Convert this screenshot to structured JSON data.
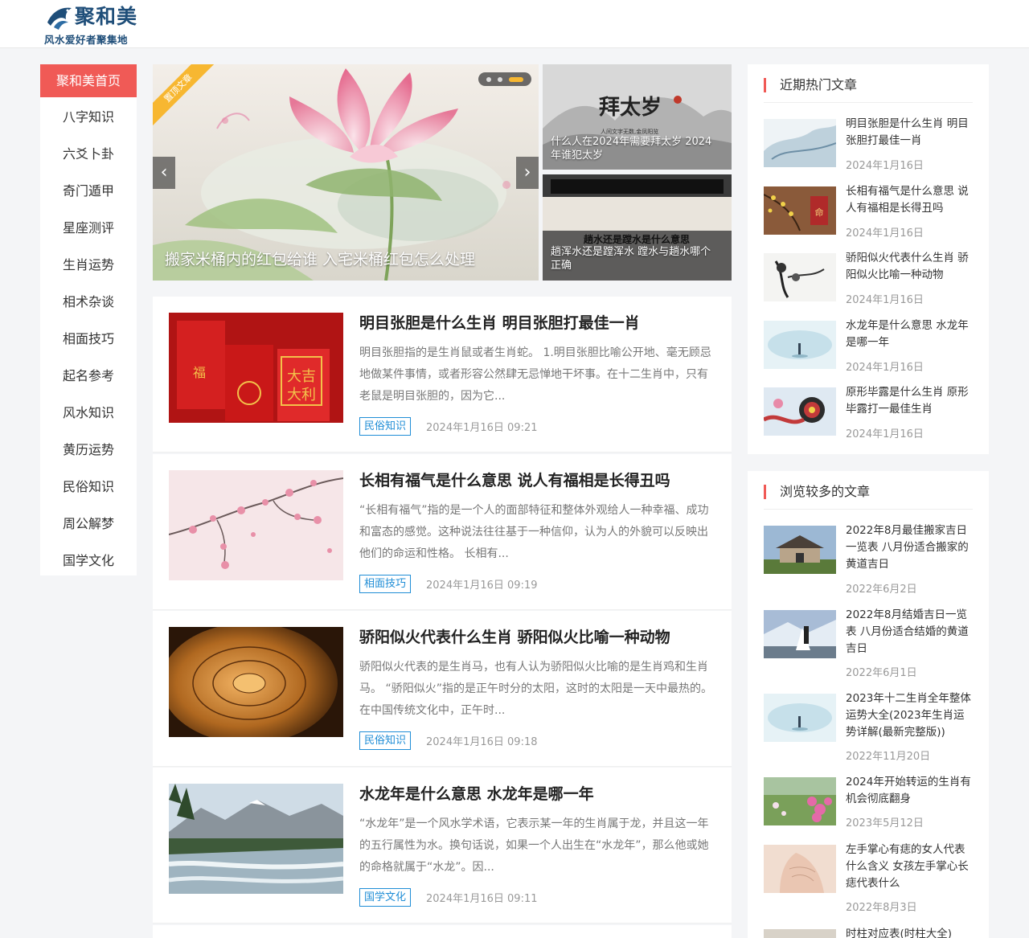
{
  "header": {
    "logo_main": "聚和美",
    "logo_sub": "风水爱好者聚集地"
  },
  "nav": {
    "items": [
      "聚和美首页",
      "八字知识",
      "六爻卜卦",
      "奇门遁甲",
      "星座测评",
      "生肖运势",
      "相术杂谈",
      "相面技巧",
      "起名参考",
      "风水知识",
      "黄历运势",
      "民俗知识",
      "周公解梦",
      "国学文化"
    ]
  },
  "banner": {
    "ribbon": "置顶文章",
    "title": "搬家米桶内的红包给谁 入宅米桶红包怎么处理",
    "prev": "‹",
    "next": "›",
    "side": [
      {
        "art_text": "拜太岁",
        "art_small": "人间文字无数,金凤阳览",
        "caption_1": "什么人在2024年需要拜太岁 2024",
        "caption_2": "年谁犯太岁"
      },
      {
        "art_text": "趟水还是蹚水是什么意思",
        "caption_1": "趟浑水还是蹚浑水 蹚水与趟水哪个",
        "caption_2": "正确"
      }
    ]
  },
  "articles": [
    {
      "title": "明目张胆是什么生肖 明目张胆打最佳一肖",
      "desc": "明目张胆指的是生肖鼠或者生肖蛇。 1.明目张胆比喻公开地、毫无顾忌地做某件事情，或者形容公然肆无忌惮地干坏事。在十二生肖中，只有老鼠是明目张胆的，因为它...",
      "tag": "民俗知识",
      "time": "2024年1月16日 09:21"
    },
    {
      "title": "长相有福气是什么意思 说人有福相是长得丑吗",
      "desc": "“长相有福气”指的是一个人的面部特征和整体外观给人一种幸福、成功和富态的感觉。这种说法往往基于一种信仰，认为人的外貌可以反映出他们的命运和性格。 长相有...",
      "tag": "相面技巧",
      "time": "2024年1月16日 09:19"
    },
    {
      "title": "骄阳似火代表什么生肖 骄阳似火比喻一种动物",
      "desc": "骄阳似火代表的是生肖马，也有人认为骄阳似火比喻的是生肖鸡和生肖马。 “骄阳似火”指的是正午时分的太阳，这时的太阳是一天中最热的。在中国传统文化中，正午时...",
      "tag": "民俗知识",
      "time": "2024年1月16日 09:18"
    },
    {
      "title": "水龙年是什么意思 水龙年是哪一年",
      "desc": "“水龙年”是一个风水学术语，它表示某一年的生肖属于龙，并且这一年的五行属性为水。换句话说，如果一个人出生在“水龙年”，那么他或她的命格就属于“水龙”。因...",
      "tag": "国学文化",
      "time": "2024年1月16日 09:11"
    }
  ],
  "hot": {
    "title": "近期热门文章",
    "items": [
      {
        "title": "明目张胆是什么生肖 明目张胆打最佳一肖",
        "date": "2024年1月16日"
      },
      {
        "title": "长相有福气是什么意思 说人有福相是长得丑吗",
        "date": "2024年1月16日"
      },
      {
        "title": "骄阳似火代表什么生肖 骄阳似火比喻一种动物",
        "date": "2024年1月16日"
      },
      {
        "title": "水龙年是什么意思 水龙年是哪一年",
        "date": "2024年1月16日"
      },
      {
        "title": "原形毕露是什么生肖 原形毕露打一最佳生肖",
        "date": "2024年1月16日"
      }
    ]
  },
  "popular": {
    "title": "浏览较多的文章",
    "items": [
      {
        "title": "2022年8月最佳搬家吉日一览表 八月份适合搬家的黄道吉日",
        "date": "2022年6月2日"
      },
      {
        "title": "2022年8月结婚吉日一览表 八月份适合结婚的黄道吉日",
        "date": "2022年6月1日"
      },
      {
        "title": "2023年十二生肖全年整体运势大全(2023年生肖运势详解(最新完整版))",
        "date": "2022年11月20日"
      },
      {
        "title": "2024年开始转运的生肖有机会彻底翻身",
        "date": "2023年5月12日"
      },
      {
        "title": "左手掌心有痣的女人代表什么含义 女孩左手掌心长痣代表什么",
        "date": "2022年8月3日"
      },
      {
        "title": "时柱对应表(时柱大全)",
        "date": ""
      }
    ]
  },
  "colors": {
    "accent": "#f05a56",
    "tag": "#1f8dd6",
    "ribbon": "#f7b731",
    "logo": "#1f4e79"
  }
}
